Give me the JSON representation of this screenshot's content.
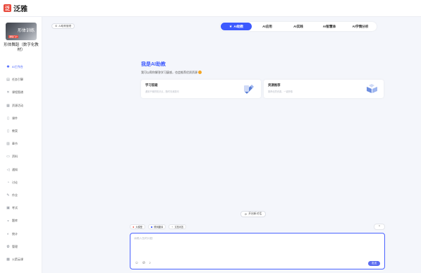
{
  "app": {
    "logo_text": "泛雅"
  },
  "sidebar": {
    "course_thumb_title": "形体训练",
    "course_thumb_badge": "课程门户",
    "course_name": "形体舞蹈（数字化教材）",
    "items": [
      {
        "label": "AI工作台",
        "icon": "robot-icon",
        "active": true
      },
      {
        "label": "任务引擎",
        "icon": "task-icon",
        "active": false
      },
      {
        "label": "课程图谱",
        "icon": "graph-icon",
        "active": false
      },
      {
        "label": "资源活动",
        "icon": "grid-icon",
        "active": false
      },
      {
        "label": "课件",
        "icon": "doc-icon",
        "active": false
      },
      {
        "label": "教案",
        "icon": "lesson-plan-icon",
        "active": false
      },
      {
        "label": "章节",
        "icon": "chapter-icon",
        "active": false
      },
      {
        "label": "资料",
        "icon": "folder-icon",
        "active": false
      },
      {
        "label": "通知",
        "icon": "speaker-icon",
        "active": false
      },
      {
        "label": "讨论",
        "icon": "chat-icon",
        "active": false
      },
      {
        "label": "作业",
        "icon": "homework-icon",
        "active": false
      },
      {
        "label": "考试",
        "icon": "exam-icon",
        "active": false
      },
      {
        "label": "题库",
        "icon": "question-bank-icon",
        "active": false
      },
      {
        "label": "统计",
        "icon": "stats-icon",
        "active": false
      },
      {
        "label": "管理",
        "icon": "gear-icon",
        "active": false
      },
      {
        "label": "火箭云课",
        "icon": "rocket-icon",
        "active": false
      }
    ]
  },
  "main": {
    "mgmt_label": "AI助教管理",
    "tabs": [
      {
        "label": "AI助教",
        "active": true
      },
      {
        "label": "AI应用",
        "active": false
      },
      {
        "label": "AI实践",
        "active": false
      },
      {
        "label": "AI智慧体",
        "active": false
      },
      {
        "label": "AI学情分析",
        "active": false
      }
    ],
    "hero_title": "我是AI助教",
    "hero_sub": "我可以帮你解答学习疑惑，也会推荐优质资源",
    "cards": [
      {
        "title": "学习答疑",
        "desc": "遇到不懂的知识点，随时向我提问"
      },
      {
        "title": "资源推荐",
        "desc": "推荐优质资源，一键获取"
      }
    ],
    "new_chat": "开启新对话",
    "tools": [
      {
        "label": "大模型",
        "icon": "model-icon",
        "color": "#e8483b"
      },
      {
        "label": "联网翻译",
        "icon": "translate-icon",
        "color": "#3d5afe"
      },
      {
        "label": "文档问答",
        "icon": "plus-icon",
        "color": "#888888"
      }
    ],
    "input_placeholder": "请输入您的问题",
    "send_label": "发送"
  },
  "colors": {
    "accent": "#3d5afe",
    "brand": "#e8483b"
  }
}
